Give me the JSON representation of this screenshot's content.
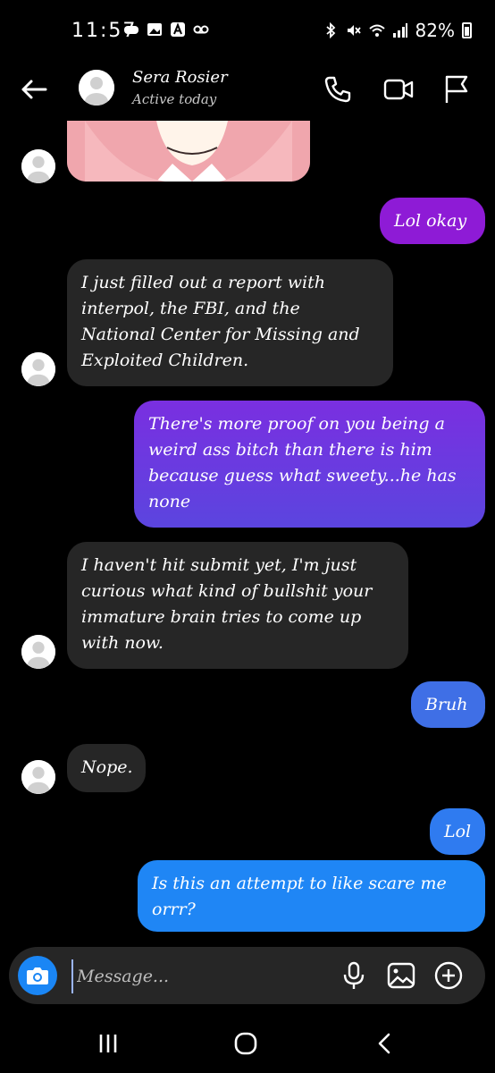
{
  "status": {
    "time": "11:57",
    "battery": "82%"
  },
  "header": {
    "name": "Sera Rosier",
    "status": "Active today"
  },
  "messages": [
    {
      "dir": "out",
      "text": "Lol okay"
    },
    {
      "dir": "in",
      "text": "I just filled out a report with interpol, the FBI, and the National Center for Missing and Exploited Children."
    },
    {
      "dir": "out",
      "text": "There's more proof on you being a weird ass bitch than there is him because guess what sweety...he has none"
    },
    {
      "dir": "in",
      "text": "I haven't hit submit yet, I'm just curious what kind of bullshit your immature brain tries to come up with now."
    },
    {
      "dir": "out",
      "text": "Bruh"
    },
    {
      "dir": "in",
      "text": "Nope."
    },
    {
      "dir": "out",
      "text": "Lol"
    },
    {
      "dir": "out",
      "text": "Is this an attempt to like scare me orrr?"
    }
  ],
  "composer": {
    "placeholder": "Message..."
  },
  "icons": {
    "back": "arrow-left-icon",
    "call": "phone-icon",
    "video": "video-camera-icon",
    "flag": "flag-icon",
    "camera": "camera-icon",
    "mic": "microphone-icon",
    "gallery": "image-icon",
    "add": "plus-circle-icon"
  },
  "colors": {
    "incoming_bubble": "#262626",
    "outgoing_purple": "#8e1bd6",
    "outgoing_blue": "#1f86f5",
    "background": "#000000"
  }
}
